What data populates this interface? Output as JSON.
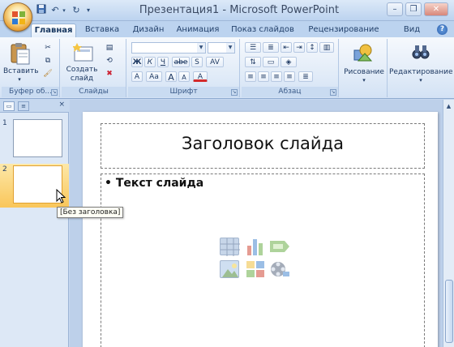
{
  "window": {
    "title": "Презентация1 - Microsoft PowerPoint",
    "minimize": "–",
    "restore": "❐",
    "close": "✕"
  },
  "qat": {
    "save_glyph": "💾",
    "undo_glyph": "↶",
    "redo_glyph": "↻",
    "more_glyph": "▾"
  },
  "tabs": [
    {
      "label": "Главная",
      "active": true
    },
    {
      "label": "Вставка"
    },
    {
      "label": "Дизайн"
    },
    {
      "label": "Анимация"
    },
    {
      "label": "Показ слайдов"
    },
    {
      "label": "Рецензирование"
    },
    {
      "label": "Вид"
    }
  ],
  "ribbon": {
    "clipboard": {
      "paste_label": "Вставить",
      "group_label": "Буфер об..."
    },
    "slides": {
      "new_slide_label": "Создать слайд",
      "group_label": "Слайды"
    },
    "font": {
      "group_label": "Шрифт",
      "bold": "Ж",
      "italic": "К",
      "underline": "Ч",
      "strike": "abe",
      "shadow": "S",
      "spacing": "AV",
      "grow": "A",
      "shrink": "A",
      "case": "Aa",
      "clear": "A",
      "color": "A"
    },
    "paragraph": {
      "group_label": "Абзац"
    },
    "drawing": {
      "label": "Рисование"
    },
    "editing": {
      "label": "Редактирование"
    }
  },
  "panel": {
    "tab_slides_glyph": "▭",
    "tab_outline_glyph": "≡",
    "close_glyph": "×",
    "slide_numbers": [
      "1",
      "2"
    ],
    "selected_index": 2,
    "tooltip": "[Без заголовка]"
  },
  "slide": {
    "title": "Заголовок слайда",
    "bullet": "•",
    "body_text": "Текст слайда"
  },
  "colors": {
    "accent": "#f9c65a",
    "ribbon_bg": "#e2ecf8",
    "window_bg": "#c5d7ef"
  }
}
